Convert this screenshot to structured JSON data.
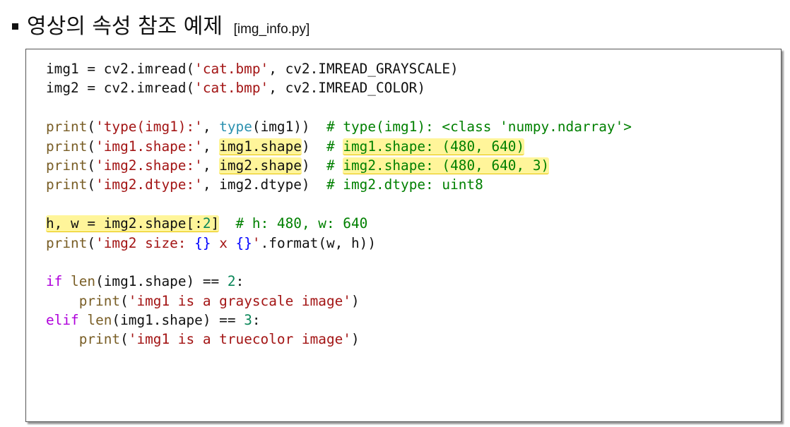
{
  "title": {
    "text": "영상의 속성 참조 예제",
    "filename": "[img_info.py]"
  },
  "code": {
    "lines": [
      [
        {
          "t": "img1 = cv2.imread(",
          "c": "plain"
        },
        {
          "t": "'cat.bmp'",
          "c": "str"
        },
        {
          "t": ", cv2.IMREAD_GRAYSCALE)",
          "c": "plain"
        }
      ],
      [
        {
          "t": "img2 = cv2.imread(",
          "c": "plain"
        },
        {
          "t": "'cat.bmp'",
          "c": "str"
        },
        {
          "t": ", cv2.IMREAD_COLOR)",
          "c": "plain"
        }
      ],
      [],
      [
        {
          "t": "print",
          "c": "bi"
        },
        {
          "t": "(",
          "c": "plain"
        },
        {
          "t": "'type(img1):'",
          "c": "str"
        },
        {
          "t": ", ",
          "c": "plain"
        },
        {
          "t": "type",
          "c": "fn"
        },
        {
          "t": "(img1))  ",
          "c": "plain"
        },
        {
          "t": "# type(img1): <class 'numpy.ndarray'>",
          "c": "cm"
        }
      ],
      [
        {
          "t": "print",
          "c": "bi"
        },
        {
          "t": "(",
          "c": "plain"
        },
        {
          "t": "'img1.shape:'",
          "c": "str"
        },
        {
          "t": ", ",
          "c": "plain"
        },
        {
          "t": "img1.shape",
          "c": "plain",
          "hl": true
        },
        {
          "t": ")  ",
          "c": "plain"
        },
        {
          "t": "# ",
          "c": "cm"
        },
        {
          "t": "img1.shape: (480, 640)",
          "c": "cm",
          "hl": true
        }
      ],
      [
        {
          "t": "print",
          "c": "bi"
        },
        {
          "t": "(",
          "c": "plain"
        },
        {
          "t": "'img2.shape:'",
          "c": "str"
        },
        {
          "t": ", ",
          "c": "plain"
        },
        {
          "t": "img2.shape",
          "c": "plain",
          "hl": true
        },
        {
          "t": ")  ",
          "c": "plain"
        },
        {
          "t": "# ",
          "c": "cm"
        },
        {
          "t": "img2.shape: (480, 640, 3)",
          "c": "cm",
          "hl": true
        }
      ],
      [
        {
          "t": "print",
          "c": "bi"
        },
        {
          "t": "(",
          "c": "plain"
        },
        {
          "t": "'img2.dtype:'",
          "c": "str"
        },
        {
          "t": ", img2.dtype)  ",
          "c": "plain"
        },
        {
          "t": "# img2.dtype: uint8",
          "c": "cm"
        }
      ],
      [],
      [
        {
          "t": "h, w = img2.shape[:",
          "c": "plain",
          "hl": true,
          "g": 1
        },
        {
          "t": "2",
          "c": "num",
          "hl": true,
          "g": 1
        },
        {
          "t": "]",
          "c": "plain",
          "hl": true,
          "g": 1
        },
        {
          "t": "  ",
          "c": "plain"
        },
        {
          "t": "# h: 480, w: 640",
          "c": "cm"
        }
      ],
      [
        {
          "t": "print",
          "c": "bi"
        },
        {
          "t": "(",
          "c": "plain"
        },
        {
          "t": "'img2 size: ",
          "c": "str"
        },
        {
          "t": "{}",
          "c": "br"
        },
        {
          "t": " x ",
          "c": "str"
        },
        {
          "t": "{}",
          "c": "br"
        },
        {
          "t": "'",
          "c": "str"
        },
        {
          "t": ".format(w, h))",
          "c": "plain"
        }
      ],
      [],
      [
        {
          "t": "if",
          "c": "kw"
        },
        {
          "t": " ",
          "c": "plain"
        },
        {
          "t": "len",
          "c": "bi"
        },
        {
          "t": "(img1.shape) == ",
          "c": "plain"
        },
        {
          "t": "2",
          "c": "num"
        },
        {
          "t": ":",
          "c": "plain"
        }
      ],
      [
        {
          "t": "    ",
          "c": "plain"
        },
        {
          "t": "print",
          "c": "bi"
        },
        {
          "t": "(",
          "c": "plain"
        },
        {
          "t": "'img1 is a grayscale image'",
          "c": "str"
        },
        {
          "t": ")",
          "c": "plain"
        }
      ],
      [
        {
          "t": "elif",
          "c": "kw"
        },
        {
          "t": " ",
          "c": "plain"
        },
        {
          "t": "len",
          "c": "bi"
        },
        {
          "t": "(img1.shape) == ",
          "c": "plain"
        },
        {
          "t": "3",
          "c": "num"
        },
        {
          "t": ":",
          "c": "plain"
        }
      ],
      [
        {
          "t": "    ",
          "c": "plain"
        },
        {
          "t": "print",
          "c": "bi"
        },
        {
          "t": "(",
          "c": "plain"
        },
        {
          "t": "'img1 is a truecolor image'",
          "c": "str"
        },
        {
          "t": ")",
          "c": "plain"
        }
      ]
    ]
  },
  "colors": {
    "string": "#a31515",
    "keyword": "#af00db",
    "builtin": "#795e26",
    "type_builtin": "#2b91af",
    "comment": "#008000",
    "number": "#098658",
    "brace": "#0000ff",
    "highlight": "#fff59a"
  }
}
